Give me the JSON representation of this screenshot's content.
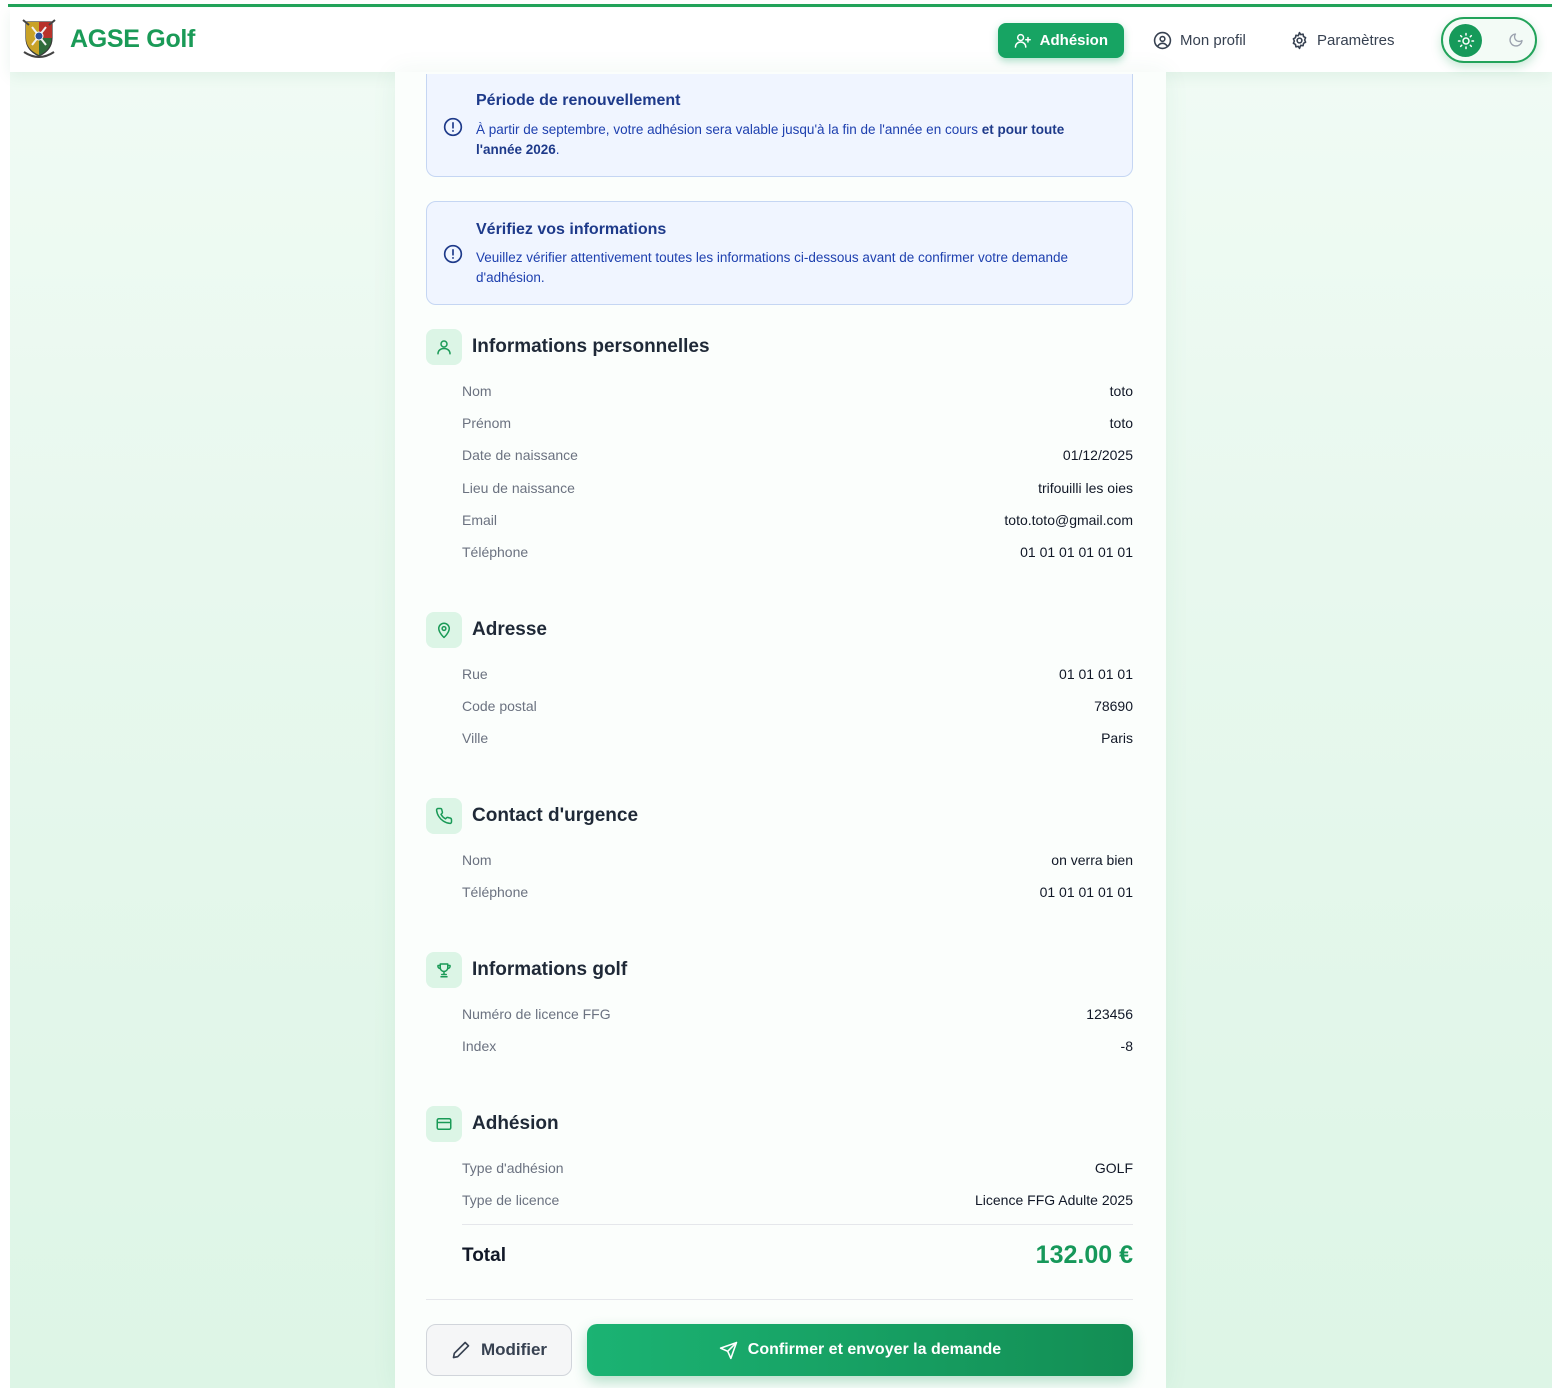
{
  "app": {
    "name": "AGSE Golf",
    "brand_color": "#1a9a57"
  },
  "nav": {
    "adhesion_label": "Adhésion",
    "profil_label": "Mon profil",
    "params_label": "Paramètres",
    "theme": "light"
  },
  "alerts": {
    "renewal": {
      "title": "Période de renouvellement",
      "text_plain": "À partir de septembre, votre adhésion sera valable jusqu'à la fin de l'année en cours",
      "text_bold": "et pour toute l'année 2026",
      "text_end": "."
    },
    "verify": {
      "title": "Vérifiez vos informations",
      "text": "Veuillez vérifier attentivement toutes les informations ci-dessous avant de confirmer votre demande d'adhésion."
    }
  },
  "sections": {
    "personal": {
      "title": "Informations personnelles",
      "icon": "user-icon",
      "rows": [
        {
          "label": "Nom",
          "value": "toto"
        },
        {
          "label": "Prénom",
          "value": "toto"
        },
        {
          "label": "Date de naissance",
          "value": "01/12/2025"
        },
        {
          "label": "Lieu de naissance",
          "value": "trifouilli les oies"
        },
        {
          "label": "Email",
          "value": "toto.toto@gmail.com"
        },
        {
          "label": "Téléphone",
          "value": "01 01 01 01 01 01"
        }
      ]
    },
    "address": {
      "title": "Adresse",
      "icon": "map-pin-icon",
      "rows": [
        {
          "label": "Rue",
          "value": "01 01 01 01"
        },
        {
          "label": "Code postal",
          "value": "78690"
        },
        {
          "label": "Ville",
          "value": "Paris"
        }
      ]
    },
    "emergency": {
      "title": "Contact d'urgence",
      "icon": "phone-icon",
      "rows": [
        {
          "label": "Nom",
          "value": "on verra bien"
        },
        {
          "label": "Téléphone",
          "value": "01 01 01 01 01"
        }
      ]
    },
    "golf": {
      "title": "Informations golf",
      "icon": "trophy-icon",
      "rows": [
        {
          "label": "Numéro de licence FFG",
          "value": "123456"
        },
        {
          "label": "Index",
          "value": "-8"
        }
      ]
    },
    "membership": {
      "title": "Adhésion",
      "icon": "credit-card-icon",
      "rows": [
        {
          "label": "Type d'adhésion",
          "value": "GOLF"
        },
        {
          "label": "Type de licence",
          "value": "Licence FFG Adulte 2025"
        }
      ],
      "total_label": "Total",
      "total_value": "132.00 €"
    }
  },
  "actions": {
    "modify_label": "Modifier",
    "confirm_label": "Confirmer et envoyer la demande"
  }
}
